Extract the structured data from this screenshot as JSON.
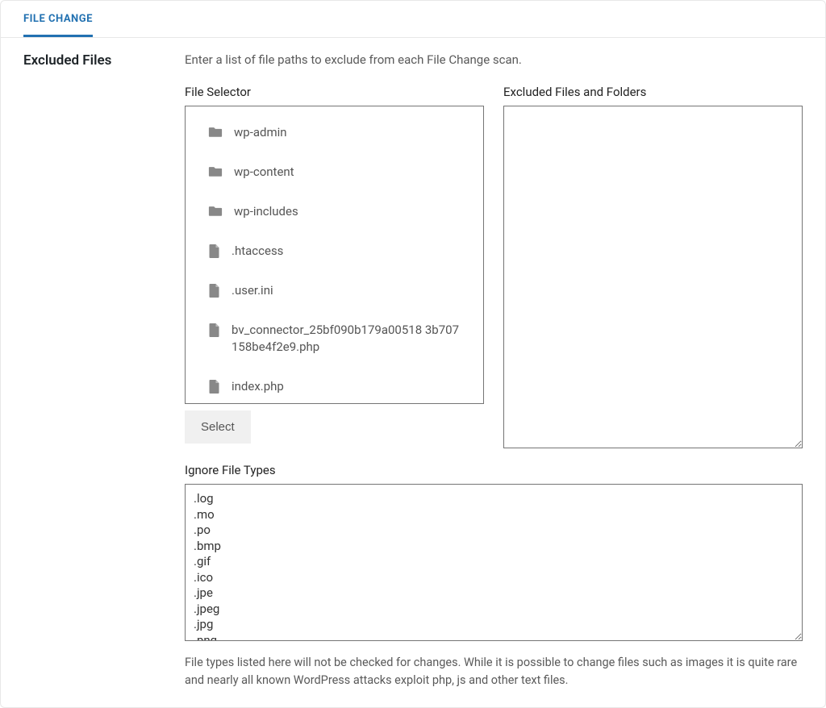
{
  "tab_label": "FILE CHANGE",
  "section_title": "Excluded Files",
  "description": "Enter a list of file paths to exclude from each File Change scan.",
  "file_selector_header": "File Selector",
  "excluded_header": "Excluded Files and Folders",
  "select_button": "Select",
  "file_items": [
    {
      "type": "folder",
      "name": "wp-admin"
    },
    {
      "type": "folder",
      "name": "wp-content"
    },
    {
      "type": "folder",
      "name": "wp-includes"
    },
    {
      "type": "file",
      "name": ".htaccess"
    },
    {
      "type": "file",
      "name": ".user.ini"
    },
    {
      "type": "file",
      "name": "bv_connector_25bf090b179a00518 3b707158be4f2e9.php"
    },
    {
      "type": "file",
      "name": "index.php"
    }
  ],
  "ignore_header": "Ignore File Types",
  "ignore_value": ".log\n.mo\n.po\n.bmp\n.gif\n.ico\n.jpe\n.jpeg\n.jpg\n.png",
  "ignore_help": "File types listed here will not be checked for changes. While it is possible to change files such as images it is quite rare and nearly all known WordPress attacks exploit php, js and other text files."
}
